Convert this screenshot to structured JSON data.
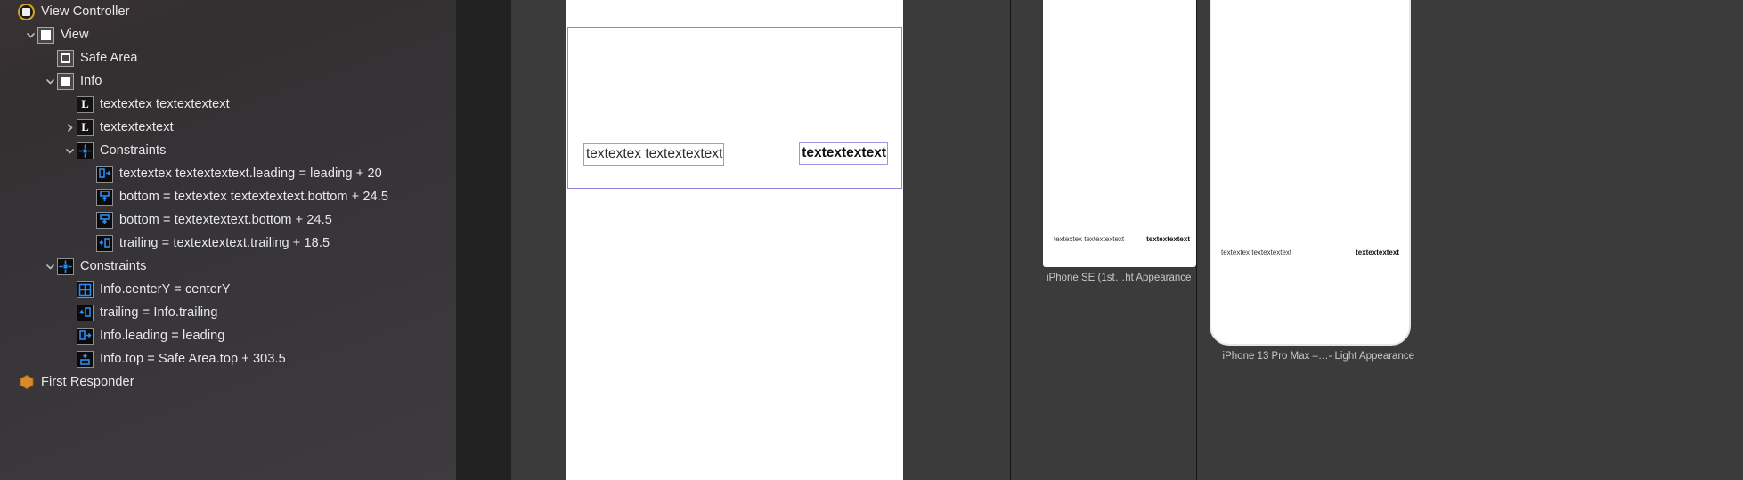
{
  "outline": {
    "rows": [
      {
        "label": "View Controller",
        "icon": "view-controller-icon",
        "depth": 0,
        "twisty": "none",
        "name": "outline-row-view-controller"
      },
      {
        "label": "View",
        "icon": "view-icon",
        "depth": 1,
        "twisty": "expanded",
        "name": "outline-row-view"
      },
      {
        "label": "Safe Area",
        "icon": "safe-area-icon",
        "depth": 2,
        "twisty": "none",
        "name": "outline-row-safe-area"
      },
      {
        "label": "Info",
        "icon": "view-icon",
        "depth": 2,
        "twisty": "expanded",
        "name": "outline-row-info"
      },
      {
        "label": "textextex textextextext",
        "icon": "label-icon",
        "depth": 3,
        "twisty": "none",
        "name": "outline-row-label-1"
      },
      {
        "label": "textextextext",
        "icon": "label-icon",
        "depth": 3,
        "twisty": "collapsed",
        "name": "outline-row-label-2"
      },
      {
        "label": "Constraints",
        "icon": "constraints-icon",
        "depth": 3,
        "twisty": "expanded",
        "name": "outline-row-constraints-info"
      },
      {
        "label": "textextex textextextext.leading = leading + 20",
        "icon": "constraint-leading-icon",
        "depth": 4,
        "twisty": "none",
        "name": "outline-row-constraint-leading"
      },
      {
        "label": "bottom = textextex textextextext.bottom + 24.5",
        "icon": "constraint-bottom-icon",
        "depth": 4,
        "twisty": "none",
        "name": "outline-row-constraint-bottom-1"
      },
      {
        "label": "bottom = textextextext.bottom + 24.5",
        "icon": "constraint-bottom-icon",
        "depth": 4,
        "twisty": "none",
        "name": "outline-row-constraint-bottom-2"
      },
      {
        "label": "trailing = textextextext.trailing + 18.5",
        "icon": "constraint-trailing-icon",
        "depth": 4,
        "twisty": "none",
        "name": "outline-row-constraint-trailing"
      },
      {
        "label": "Constraints",
        "icon": "constraints-icon",
        "depth": 2,
        "twisty": "expanded",
        "name": "outline-row-constraints-view"
      },
      {
        "label": "Info.centerY = centerY",
        "icon": "constraint-center-icon",
        "depth": 3,
        "twisty": "none",
        "name": "outline-row-constraint-centery"
      },
      {
        "label": "trailing = Info.trailing",
        "icon": "constraint-trailing-icon",
        "depth": 3,
        "twisty": "none",
        "name": "outline-row-constraint-info-trailing"
      },
      {
        "label": "Info.leading = leading",
        "icon": "constraint-leading-icon",
        "depth": 3,
        "twisty": "none",
        "name": "outline-row-constraint-info-leading"
      },
      {
        "label": "Info.top = Safe Area.top + 303.5",
        "icon": "constraint-top-icon",
        "depth": 3,
        "twisty": "none",
        "name": "outline-row-constraint-info-top"
      },
      {
        "label": "First Responder",
        "icon": "first-responder-icon",
        "depth": 0,
        "twisty": "none",
        "name": "outline-row-first-responder"
      }
    ]
  },
  "canvas": {
    "labels": [
      {
        "text": "textextex textextextext",
        "bold": false,
        "name": "canvas-label-left"
      },
      {
        "text": "textextextext",
        "bold": true,
        "name": "canvas-label-right"
      }
    ]
  },
  "previews": [
    {
      "caption": "iPhone SE (1st…ht Appearance",
      "name": "preview-iphone-se",
      "labels": [
        {
          "text": "textextex textextextext",
          "bold": false
        },
        {
          "text": "textextextext",
          "bold": true
        }
      ]
    },
    {
      "caption": "iPhone 13 Pro Max –…- Light Appearance",
      "name": "preview-iphone-13-pro-max",
      "labels": [
        {
          "text": "textextex textextextext",
          "bold": false
        },
        {
          "text": "textextextext",
          "bold": true
        }
      ]
    }
  ],
  "colors": {
    "selection_border": "#8a86e0",
    "constraint_icon": "#2a8cf0",
    "view_controller_ring": "#d4a428",
    "first_responder": "#d98a2b"
  }
}
